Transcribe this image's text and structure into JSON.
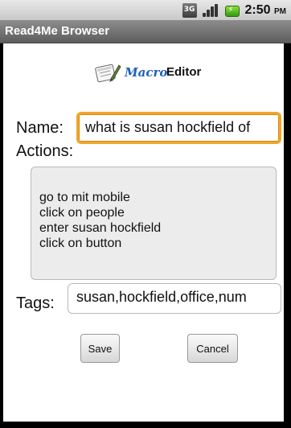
{
  "status_bar": {
    "network_label": "3G",
    "time": "2:50",
    "ampm": "PM",
    "icons": [
      "3g-icon",
      "signal-icon",
      "battery-charging-icon"
    ]
  },
  "title_bar": {
    "title": "Read4Me Browser"
  },
  "logo": {
    "macro_text": "Macro",
    "editor_text": "Editor"
  },
  "form": {
    "name_label": "Name:",
    "name_value": "what is susan hockfield of",
    "actions_label": "Actions:",
    "actions": [
      "go to mit mobile",
      "click on people",
      "enter susan hockfield",
      "click on button"
    ],
    "tags_label": "Tags:",
    "tags_value": "susan,hockfield,office,num"
  },
  "buttons": {
    "save_label": "Save",
    "cancel_label": "Cancel"
  },
  "colors": {
    "focus_border": "#f0a825",
    "title_bar": "#6f6f6f",
    "logo_macro": "#1f62b3"
  }
}
